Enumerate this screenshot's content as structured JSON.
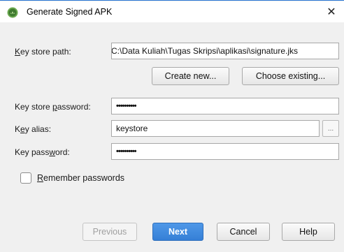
{
  "window": {
    "title": "Generate Signed APK",
    "close_glyph": "✕"
  },
  "form": {
    "key_store_path": {
      "label_mnemonic": "K",
      "label_rest": "ey store path:",
      "value": "C:\\Data Kuliah\\Tugas Skripsi\\aplikasi\\signature.jks"
    },
    "create_new_label": "Create new...",
    "choose_existing_label": "Choose existing...",
    "key_store_password": {
      "label_before": "Key store ",
      "label_mnemonic": "p",
      "label_after": "assword:",
      "value": "••••••••••"
    },
    "key_alias": {
      "label_before": "K",
      "label_mnemonic": "e",
      "label_after": "y alias:",
      "value": "keystore",
      "browse_label": "..."
    },
    "key_password": {
      "label_before": "Key pass",
      "label_mnemonic": "w",
      "label_after": "ord:",
      "value": "••••••••••"
    },
    "remember": {
      "label_mnemonic": "R",
      "label_rest": "emember passwords",
      "checked": false
    }
  },
  "footer": {
    "previous_label": "Previous",
    "next_label": "Next",
    "cancel_label": "Cancel",
    "help_label": "Help"
  },
  "colors": {
    "accent": "#357fd6",
    "window_bg": "#f0f0f0",
    "title_border": "#2b78d6"
  },
  "icons": {
    "app_icon": "android-studio-icon"
  }
}
